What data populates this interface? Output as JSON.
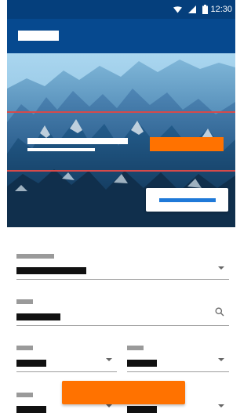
{
  "status": {
    "time": "12:30",
    "icons": [
      "wifi-icon",
      "signal-icon",
      "battery-icon"
    ]
  },
  "app": {
    "bar_color": "#06498f",
    "status_color": "#053f7c"
  },
  "hero": {
    "image": "mountain-range-icon",
    "primary_color": "#ff7200",
    "secondary_text_color": "#1f79d8"
  },
  "form": {
    "fields": [
      {
        "name": "first-dropdown",
        "icon": "chevron-down-icon"
      },
      {
        "name": "search-field",
        "icon": "search-icon"
      },
      {
        "name": "left-select",
        "icon": "chevron-down-icon"
      },
      {
        "name": "right-select",
        "icon": "chevron-down-icon"
      },
      {
        "name": "bottom-left-select",
        "icon": "chevron-down-icon"
      },
      {
        "name": "bottom-right-select",
        "icon": "chevron-down-icon"
      }
    ]
  }
}
